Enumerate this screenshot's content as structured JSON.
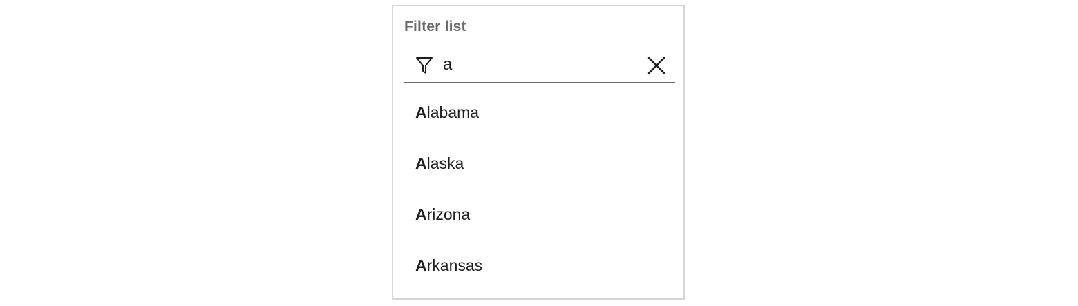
{
  "filter": {
    "label": "Filter list",
    "value": "a",
    "icons": {
      "filter": "funnel-icon",
      "clear": "close-icon"
    }
  },
  "list": {
    "items": [
      {
        "match": "A",
        "rest": "labama"
      },
      {
        "match": "A",
        "rest": "laska"
      },
      {
        "match": "A",
        "rest": "rizona"
      },
      {
        "match": "A",
        "rest": "rkansas"
      }
    ]
  },
  "colors": {
    "border": "#d6d6d6",
    "label": "#6b6b6b",
    "text": "#1e1e1e",
    "underline": "#6e6e6e"
  }
}
